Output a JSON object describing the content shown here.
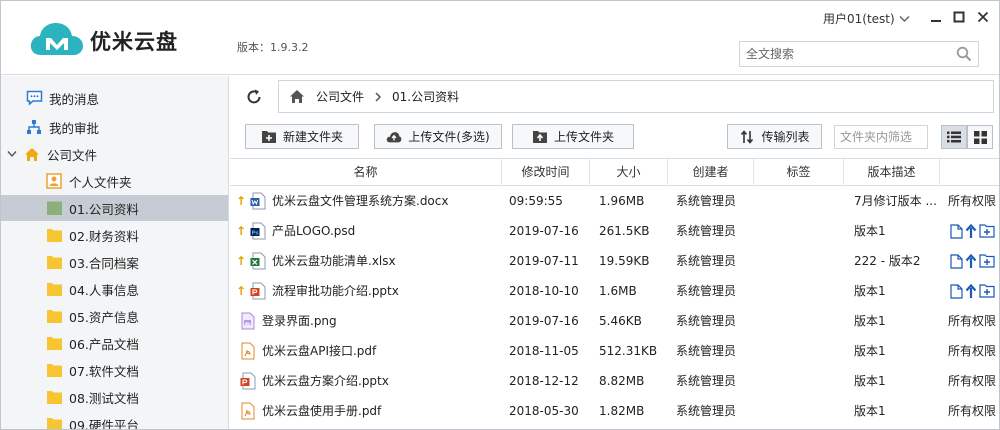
{
  "app": {
    "brand": "优米云盘",
    "version": "版本：1.9.3.2",
    "user": "用户01(test)",
    "search_placeholder": "全文搜索",
    "colors": {
      "brand": "#2bb3c0",
      "folder": "#f7c531",
      "accent_blue": "#1a5bb5"
    }
  },
  "sidebar": {
    "items": [
      {
        "label": "我的消息",
        "icon": "message-icon"
      },
      {
        "label": "我的审批",
        "icon": "org-chart-icon"
      },
      {
        "label": "公司文件",
        "icon": "home-icon",
        "expanded": true
      },
      {
        "label": "个人文件夹",
        "icon": "personal-folder-icon"
      },
      {
        "label": "01.公司资料",
        "icon": "folder-icon",
        "active": true
      },
      {
        "label": "02.财务资料",
        "icon": "folder-icon"
      },
      {
        "label": "03.合同档案",
        "icon": "folder-icon"
      },
      {
        "label": "04.人事信息",
        "icon": "folder-icon"
      },
      {
        "label": "05.资产信息",
        "icon": "folder-icon"
      },
      {
        "label": "06.产品文档",
        "icon": "folder-icon"
      },
      {
        "label": "07.软件文档",
        "icon": "folder-icon"
      },
      {
        "label": "08.测试文档",
        "icon": "folder-icon"
      },
      {
        "label": "09.硬件平台",
        "icon": "folder-icon"
      }
    ]
  },
  "breadcrumb": {
    "root": "公司文件",
    "current": "01.公司资料"
  },
  "toolbar": {
    "new_folder": "新建文件夹",
    "upload_files": "上传文件(多选)",
    "upload_folder": "上传文件夹",
    "transfer_list": "传输列表",
    "filter_placeholder": "文件夹内筛选"
  },
  "table": {
    "columns": [
      "名称",
      "修改时间",
      "大小",
      "创建者",
      "标签",
      "版本描述"
    ],
    "rows": [
      {
        "name": "优米云盘文件管理系统方案.docx",
        "type": "docx",
        "updated": true,
        "time": "09:59:55",
        "size": "1.96MB",
        "creator": "系统管理员",
        "version": "7月修订版本 ...",
        "perm": "所有权限"
      },
      {
        "name": "产品LOGO.psd",
        "type": "psd",
        "updated": true,
        "time": "2019-07-16",
        "size": "261.5KB",
        "creator": "系统管理员",
        "version": "版本1",
        "perm": ""
      },
      {
        "name": "优米云盘功能清单.xlsx",
        "type": "xlsx",
        "updated": true,
        "time": "2019-07-11",
        "size": "19.59KB",
        "creator": "系统管理员",
        "version": "222 - 版本2",
        "perm": ""
      },
      {
        "name": "流程审批功能介绍.pptx",
        "type": "pptx",
        "updated": true,
        "time": "2018-10-10",
        "size": "1.6MB",
        "creator": "系统管理员",
        "version": "版本1",
        "perm": ""
      },
      {
        "name": "登录界面.png",
        "type": "png",
        "updated": false,
        "time": "2019-07-16",
        "size": "5.46KB",
        "creator": "系统管理员",
        "version": "版本1",
        "perm": "所有权限"
      },
      {
        "name": "优米云盘API接口.pdf",
        "type": "pdf",
        "updated": false,
        "time": "2018-11-05",
        "size": "512.31KB",
        "creator": "系统管理员",
        "version": "版本1",
        "perm": "所有权限"
      },
      {
        "name": "优米云盘方案介绍.pptx",
        "type": "pptx",
        "updated": false,
        "time": "2018-12-12",
        "size": "8.82MB",
        "creator": "系统管理员",
        "version": "版本1",
        "perm": "所有权限"
      },
      {
        "name": "优米云盘使用手册.pdf",
        "type": "pdf",
        "updated": false,
        "time": "2018-05-30",
        "size": "1.82MB",
        "creator": "系统管理员",
        "version": "版本1",
        "perm": "所有权限"
      }
    ]
  }
}
